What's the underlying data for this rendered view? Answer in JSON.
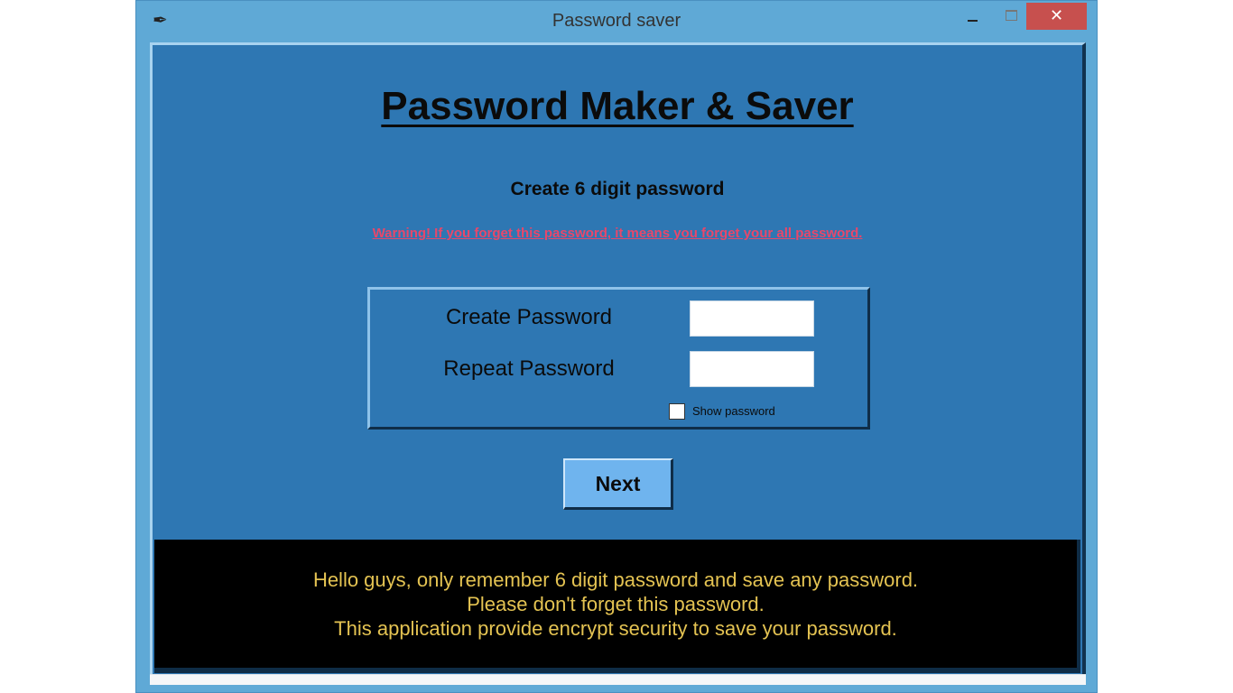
{
  "window": {
    "title": "Password saver",
    "icon": "feather-icon",
    "controls": {
      "minimize": "",
      "maximize": "",
      "close": "✕"
    }
  },
  "header": {
    "title": "Password Maker & Saver",
    "subtitle": "Create 6 digit password",
    "warning": "Warning! If you forget this password, it means you forget your all password."
  },
  "form": {
    "create_label": "Create Password",
    "create_value": "",
    "repeat_label": "Repeat Password",
    "repeat_value": "",
    "show_password_label": "Show password",
    "show_password_checked": false
  },
  "actions": {
    "next_label": "Next"
  },
  "info": {
    "lines": [
      "Hello guys, only remember 6 digit password and save any password.",
      "Please don't forget this password.",
      "This application provide encrypt security to save your password."
    ]
  },
  "colors": {
    "background": "#2e77b3",
    "warning": "#e8476a",
    "info_text": "#e4c352",
    "button": "#6fb4ee",
    "close": "#c7504e"
  }
}
